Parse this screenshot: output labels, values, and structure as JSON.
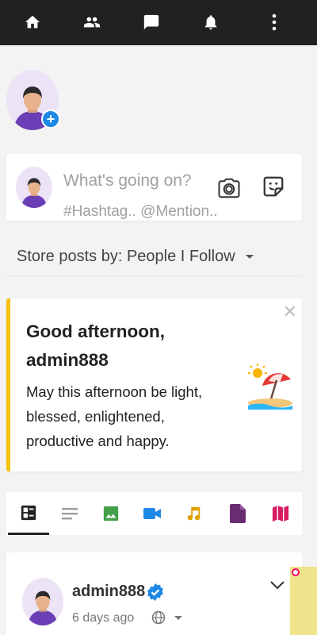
{
  "nav": {
    "items": [
      {
        "icon": "home-icon"
      },
      {
        "icon": "people-icon"
      },
      {
        "icon": "chat-icon"
      },
      {
        "icon": "bell-icon"
      },
      {
        "icon": "more-vert-icon"
      }
    ]
  },
  "composer": {
    "placeholder_line1": "What's going on?",
    "placeholder_line2": "#Hashtag.. @Mention.."
  },
  "sort": {
    "label": "Store posts by: People I Follow"
  },
  "greeting": {
    "title": "Good afternoon, admin888",
    "message": "May this afternoon be light, blessed, enlightened, productive and happy.",
    "accent_color": "#f6c20a"
  },
  "post_tabs": [
    {
      "icon": "all-posts-icon",
      "color": "#222222",
      "active": true
    },
    {
      "icon": "text-icon",
      "color": "#9e9e9e"
    },
    {
      "icon": "image-icon",
      "color": "#43a047"
    },
    {
      "icon": "video-icon",
      "color": "#1e88e5"
    },
    {
      "icon": "music-icon",
      "color": "#e0a000"
    },
    {
      "icon": "file-icon",
      "color": "#6a2c70"
    },
    {
      "icon": "map-icon",
      "color": "#d81b60"
    }
  ],
  "post": {
    "username": "admin888",
    "time": "6 days ago"
  },
  "colors": {
    "topbar": "#212121",
    "accent_blue": "#1e88e5"
  }
}
